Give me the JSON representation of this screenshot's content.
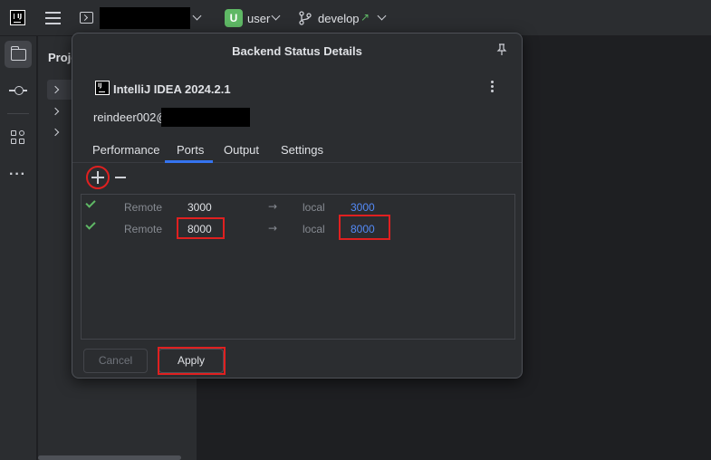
{
  "colors": {
    "accent": "#3574f0",
    "highlight": "#e02020",
    "success": "#5fb865",
    "link": "#548af7",
    "user_badge": "#5fb865"
  },
  "toolbar": {
    "user_initial": "U",
    "user_name": "user",
    "branch": "develop",
    "branch_indicator": "↗"
  },
  "project_panel": {
    "title": "Proje"
  },
  "dialog": {
    "title": "Backend Status Details",
    "ide_name": "IntelliJ IDEA 2024.2.1",
    "connection_user": "reindeer002@",
    "tabs": [
      {
        "label": "Performance"
      },
      {
        "label": "Ports",
        "selected": true
      },
      {
        "label": "Output"
      },
      {
        "label": "Settings"
      }
    ],
    "ports": [
      {
        "remote_label": "Remote",
        "remote_port": "3000",
        "arrow": "→",
        "local_label": "local",
        "local_port": "3000"
      },
      {
        "remote_label": "Remote",
        "remote_port": "8000",
        "arrow": "→",
        "local_label": "local",
        "local_port": "8000"
      }
    ],
    "buttons": {
      "cancel": "Cancel",
      "apply": "Apply"
    }
  }
}
